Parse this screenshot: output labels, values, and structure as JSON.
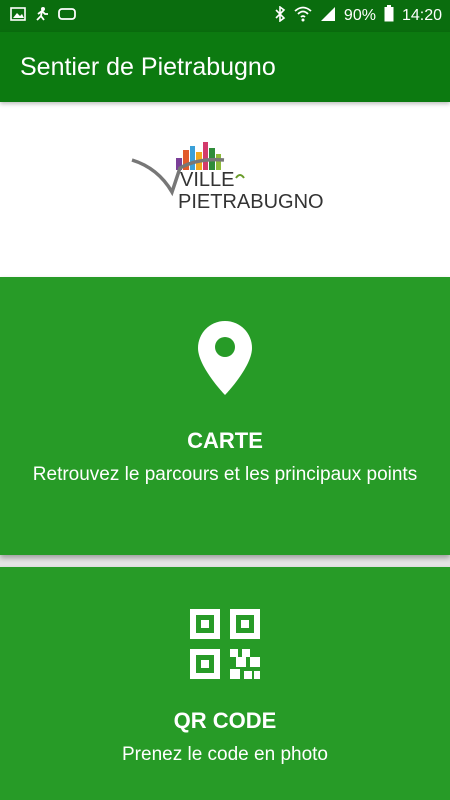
{
  "status_bar": {
    "battery_percent": "90%",
    "time": "14:20",
    "icons": [
      "image-icon",
      "run-icon",
      "vr-icon",
      "bluetooth-icon",
      "wifi-icon",
      "signal-icon",
      "battery-icon"
    ]
  },
  "app_bar": {
    "title": "Sentier de Pietrabugno"
  },
  "logo": {
    "line1": "VILLE",
    "line2": "PIETRABUGNO",
    "icon": "ville-pietrabugno-logo"
  },
  "cards": {
    "carte": {
      "title": "CARTE",
      "description": "Retrouvez le parcours et les principaux points",
      "icon": "map-pin-icon"
    },
    "qrcode": {
      "title": "QR CODE",
      "description": "Prenez le code en photo",
      "icon": "qr-code-icon"
    }
  },
  "colors": {
    "status_bar": "#0a6d0e",
    "app_bar": "#0c7a10",
    "card": "#279b27",
    "background": "#e4e4e4"
  }
}
